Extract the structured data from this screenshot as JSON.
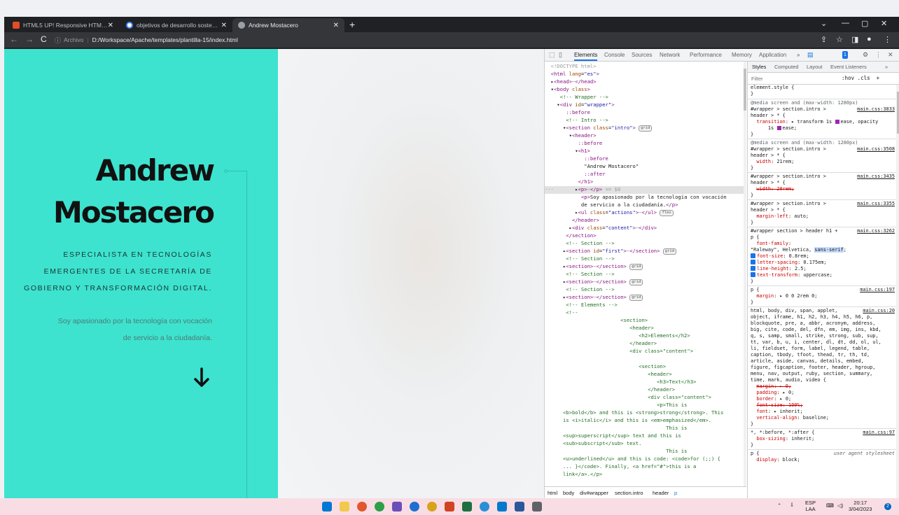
{
  "browser": {
    "tabs": [
      {
        "title": "HTML5 UP! Responsive HTML5 a",
        "color": "#e44d26"
      },
      {
        "title": "objetivos de desarrollo sostenibl",
        "color": "#4285f4"
      },
      {
        "title": "Andrew Mostacero",
        "color": "#e8eaed"
      }
    ],
    "new_tab": "+",
    "address": {
      "info_label": "Archivo",
      "separator": "|",
      "url": "D:/Workspace/Apache/templates/plantilla-15/index.html"
    }
  },
  "page": {
    "accent": "#3de3cf",
    "title_line1": "Andrew",
    "title_line2": "Mostacero",
    "tagline_1": "ESPECIALISTA EN TECNOLOGÍAS",
    "tagline_2": "EMERGENTES DE LA SECRETARÍA DE",
    "tagline_3": "GOBIERNO Y TRANSFORMACIÓN DIGITAL.",
    "description_1": "Soy apasionado por la tecnología con vocación",
    "description_2": "de servicio a la ciudadanía."
  },
  "devtools": {
    "tabs": [
      "Elements",
      "Console",
      "Sources",
      "Network",
      "Performance",
      "Memory",
      "Application"
    ],
    "more": "»",
    "badge": "1",
    "styles_tabs": [
      "Styles",
      "Computed",
      "Layout",
      "Event Listeners",
      "»"
    ],
    "filter_placeholder": "Filter",
    "filter_tools": ":hov .cls  +",
    "breadcrumbs": [
      "html",
      "body",
      "div#wrapper",
      "section.intro",
      "header",
      "p"
    ]
  },
  "taskbar": {
    "lang_1": "ESP",
    "lang_2": "LAA",
    "time": "20:17",
    "date": "3/04/2023",
    "notifications": "2"
  }
}
